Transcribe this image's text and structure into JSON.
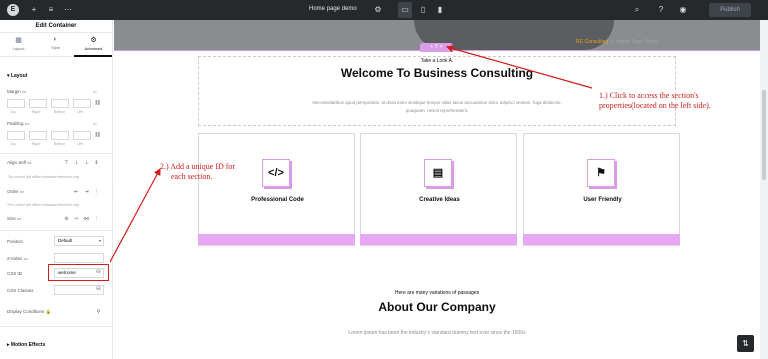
{
  "topbar": {
    "page_title": "Home page demo",
    "publish_label": "Publish",
    "icons": [
      "elementor-logo-icon",
      "plus-icon",
      "structure-icon",
      "dots-icon",
      "settings-icon",
      "desktop-icon",
      "tablet-icon",
      "mobile-icon",
      "search-icon",
      "help-icon",
      "preview-icon"
    ]
  },
  "panel": {
    "title": "Edit Container",
    "tabs": [
      {
        "label": "Layout",
        "icon": "layout-icon"
      },
      {
        "label": "Style",
        "icon": "style-icon"
      },
      {
        "label": "Advanced",
        "icon": "gear-icon"
      }
    ],
    "layout_section": "Layout",
    "margin_label": "Margin",
    "padding_label": "Padding",
    "unit": "px",
    "sides": [
      "Top",
      "Right",
      "Bottom",
      "Left"
    ],
    "align_self_label": "Align Self",
    "align_note": "This control will affect contained elements only.",
    "order_label": "Order",
    "order_note": "This control will affect contained elements only.",
    "size_label": "Size",
    "position_label": "Position",
    "position_value": "Default",
    "zindex_label": "Z-Index",
    "cssid_label": "CSS ID",
    "cssid_value": "welcome",
    "cssclasses_label": "CSS Classes",
    "display_conditions_label": "Display Conditions",
    "motion_effects_label": "Motion Effects"
  },
  "canvas": {
    "breadcrumb": [
      "RC Consulting",
      ">",
      "Home Page Demo"
    ],
    "section_handle": "+ ⠿ ×",
    "take_a_look": "Take a Look A.",
    "welcome_title": "Welcome To Business Consulting",
    "welcome_lorem": "Neccessitatibus quod perspiciatis, at dicta enim similique tempor alias lacus accusamus dolor adipisci veniam, fuga distinctio, quaquam, nescit reprehenderit.",
    "cards": [
      {
        "title": "Professional Code",
        "icon": "code-icon"
      },
      {
        "title": "Creative Ideas",
        "icon": "ideas-icon"
      },
      {
        "title": "User Friendly",
        "icon": "bookmark-icon"
      }
    ],
    "about_sub": "Here are many variations of passages",
    "about_title": "About Our Company",
    "about_lorem": "Lorem ipsum has been the industry's standard dummy text ever since the 1500s"
  },
  "annotations": {
    "note1_line1": "1.) Click to access the section's",
    "note1_line2": "properties(located on the left side).",
    "note2_line1": "2.) Add a unique ID for",
    "note2_line2": "each section.",
    "color": "#d31b1b"
  },
  "colors": {
    "topbar": "#26292c",
    "selection": "#d99de8",
    "card_bar": "#e7a7f2",
    "breadcrumb_accent": "#e7a21b"
  }
}
